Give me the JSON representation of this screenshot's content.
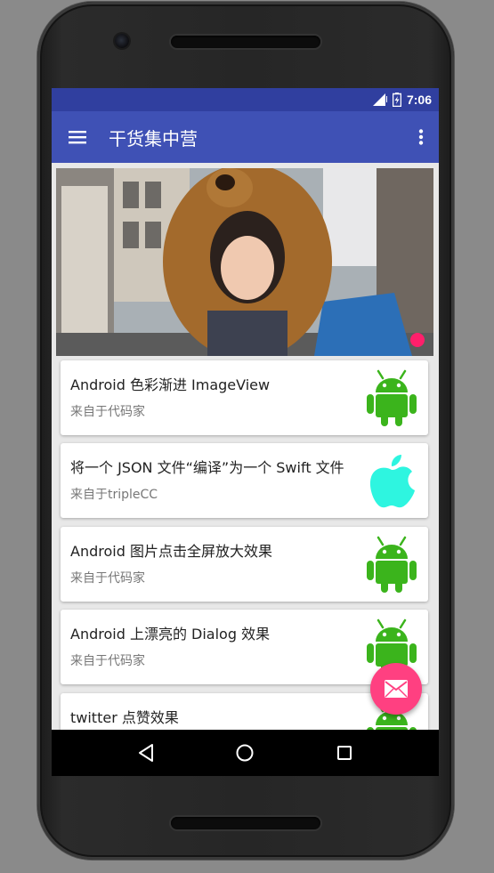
{
  "status_bar": {
    "time": "7:06"
  },
  "app_bar": {
    "title": "干货集中营"
  },
  "articles": [
    {
      "title": "Android 色彩渐进 ImageView",
      "source": "来自于代码家",
      "icon": "android-icon"
    },
    {
      "title": "将一个 JSON 文件“编译”为一个 Swift 文件",
      "source": "来自于tripleCC",
      "icon": "apple-icon"
    },
    {
      "title": "Android 图片点击全屏放大效果",
      "source": "来自于代码家",
      "icon": "android-icon"
    },
    {
      "title": "Android 上漂亮的 Dialog 效果",
      "source": "来自于代码家",
      "icon": "android-icon"
    },
    {
      "title": "twitter 点赞效果",
      "source": "",
      "icon": "android-icon"
    }
  ],
  "colors": {
    "status_bar": "#303f9f",
    "app_bar": "#3f51b5",
    "accent": "#ff4081",
    "android_green": "#3bb41c",
    "apple_cyan": "#2ef5e0"
  },
  "fab": {
    "icon": "mail-icon"
  },
  "nav_bar": {
    "icons": [
      "back-icon",
      "home-icon",
      "recents-icon"
    ]
  }
}
